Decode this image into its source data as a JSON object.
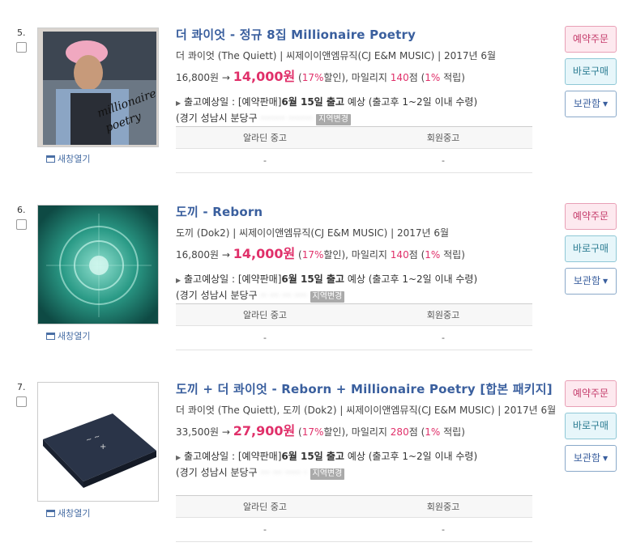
{
  "items": [
    {
      "num": "5.",
      "title": "더 콰이엇 - 정규 8집 Millionaire Poetry",
      "meta": "더 콰이엇 (The Quiett) | 씨제이이앤엠뮤직(CJ E&M MUSIC) | 2017년 6월",
      "list_price": "16,800원",
      "arrow": "→",
      "sale_price": "14,000원",
      "discount_pct": "17%",
      "discount_word": "할인",
      "mileage_label": "마일리지",
      "mileage": "140",
      "mileage_unit": "점",
      "mileage_rate": "1%",
      "mileage_rate_word": "적립",
      "ship_label": "출고예상일 :",
      "ship_tag": "[예약판매]",
      "ship_date": "6월 15일 출고",
      "ship_note": "예상 (출고후 1~2일 이내 수령)",
      "address": "(경기 성남시 분당구",
      "address_hidden": "········ ········",
      "region_button": "지역변경",
      "new_window": "새창열기",
      "used_headers": [
        "알라딘 중고",
        "회원중고"
      ],
      "used_values": [
        "-",
        "-"
      ],
      "btn_reserve": "예약주문",
      "btn_buy": "바로구매",
      "btn_keep": "보관함"
    },
    {
      "num": "6.",
      "title": "도끼 - Reborn",
      "meta": "도끼 (Dok2) | 씨제이이앤엠뮤직(CJ E&M MUSIC) | 2017년 6월",
      "list_price": "16,800원",
      "arrow": "→",
      "sale_price": "14,000원",
      "discount_pct": "17%",
      "discount_word": "할인",
      "mileage_label": "마일리지",
      "mileage": "140",
      "mileage_unit": "점",
      "mileage_rate": "1%",
      "mileage_rate_word": "적립",
      "ship_label": "출고예상일 :",
      "ship_tag": "[예약판매]",
      "ship_date": "6월 15일 출고",
      "ship_note": "예상 (출고후 1~2일 이내 수령)",
      "address": "(경기 성남시 분당구",
      "address_hidden": "·· ··· ··· ····",
      "region_button": "지역변경",
      "new_window": "새창열기",
      "used_headers": [
        "알라딘 중고",
        "회원중고"
      ],
      "used_values": [
        "-",
        "-"
      ],
      "btn_reserve": "예약주문",
      "btn_buy": "바로구매",
      "btn_keep": "보관함"
    },
    {
      "num": "7.",
      "title": "도끼 + 더 콰이엇 - Reborn + Millionaire Poetry [합본 패키지]",
      "meta": "더 콰이엇 (The Quiett), 도끼 (Dok2) | 씨제이이앤엠뮤직(CJ E&M MUSIC) | 2017년 6월",
      "list_price": "33,500원",
      "arrow": "→",
      "sale_price": "27,900원",
      "discount_pct": "17%",
      "discount_word": "할인",
      "mileage_label": "마일리지",
      "mileage": "280",
      "mileage_unit": "점",
      "mileage_rate": "1%",
      "mileage_rate_word": "적립",
      "ship_label": "출고예상일 :",
      "ship_tag": "[예약판매]",
      "ship_date": "6월 15일 출고",
      "ship_note": "예상 (출고후 1~2일 이내 수령)",
      "address": "(경기 성남시 분당구",
      "address_hidden": "··· ··· ····· ·",
      "region_button": "지역변경",
      "new_window": "새창열기",
      "used_headers": [
        "알라딘 중고",
        "회원중고"
      ],
      "used_values": [
        "-",
        "-"
      ],
      "btn_reserve": "예약주문",
      "btn_buy": "바로구매",
      "btn_keep": "보관함"
    }
  ],
  "colors": {
    "title": "#3a5f9e",
    "price_accent": "#e0306a",
    "reserve_bg": "#fde9ef",
    "buy_bg": "#e7f6fa"
  },
  "icons": [
    "checkbox",
    "new-window-icon",
    "triangle-bullet-icon",
    "chevron-down-icon"
  ]
}
